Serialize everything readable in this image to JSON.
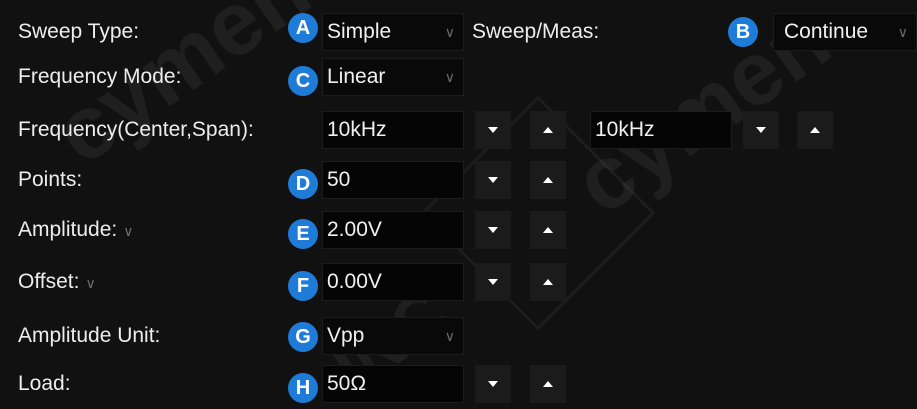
{
  "sweep_type": {
    "label": "Sweep Type:",
    "badge": "A",
    "value": "Simple"
  },
  "sweep_meas": {
    "label": "Sweep/Meas:",
    "badge": "B",
    "value": "Continue"
  },
  "frequency_mode": {
    "label": "Frequency Mode:",
    "badge": "C",
    "value": "Linear"
  },
  "frequency": {
    "label": "Frequency(Center,Span):",
    "center_value": "10kHz",
    "span_value": "10kHz"
  },
  "points": {
    "label": "Points:",
    "badge": "D",
    "value": "50"
  },
  "amplitude": {
    "label": "Amplitude:",
    "badge": "E",
    "value": "2.00V"
  },
  "offset": {
    "label": "Offset:",
    "badge": "F",
    "value": "0.00V"
  },
  "amplitude_unit": {
    "label": "Amplitude Unit:",
    "badge": "G",
    "value": "Vpp"
  },
  "load": {
    "label": "Load:",
    "badge": "H",
    "value": "50Ω"
  },
  "glyphs": {
    "caret": "∨"
  },
  "watermark": {
    "text_a": "cymen",
    "text_b": "SIGLENT",
    "text_c": "INC"
  },
  "colors": {
    "badge": "#1f7bd8",
    "background": "#111111",
    "field": "#050505",
    "button": "#1b1b1b"
  },
  "icons": {
    "decrement": "triangle-down-icon",
    "increment": "triangle-up-icon",
    "dropdown": "chevron-down-icon"
  }
}
